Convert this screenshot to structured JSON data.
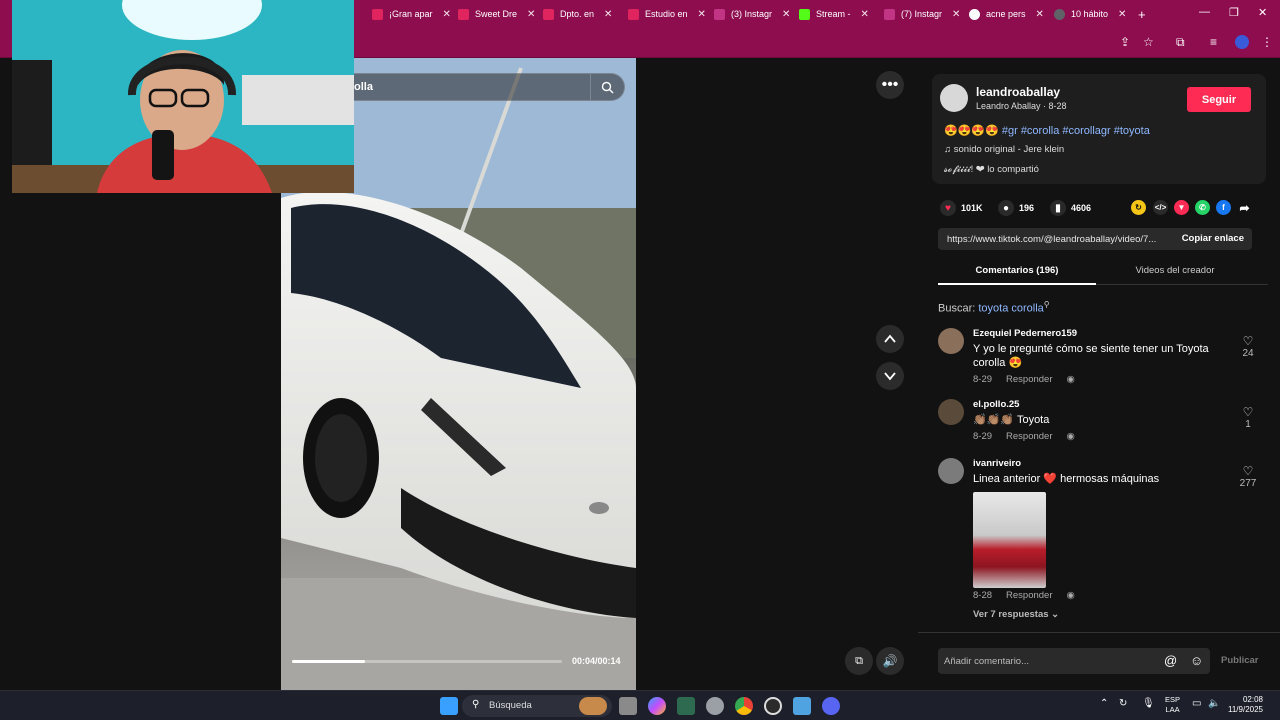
{
  "browser": {
    "tabs": [
      {
        "label": "¡Gran apar",
        "color": "#e0245e"
      },
      {
        "label": "Sweet Dre",
        "color": "#e0245e"
      },
      {
        "label": "Dpto. en",
        "color": "#e0245e"
      },
      {
        "label": "Estudio en",
        "color": "#e0245e"
      },
      {
        "label": "(3) Instagr",
        "color": "#c13584"
      },
      {
        "label": "Stream -",
        "color": "#53fc18"
      },
      {
        "label": "(7) Instagr",
        "color": "#c13584"
      },
      {
        "label": "acne pers",
        "color": "#ffffff"
      },
      {
        "label": "10 hábito",
        "color": "#5f6368"
      }
    ],
    "new_tab": "+",
    "window_controls": [
      "—",
      "❐",
      "✕"
    ]
  },
  "video": {
    "search_text": "olla",
    "time": "00:04/00:14",
    "progress": 0.27
  },
  "post": {
    "username": "leandroaballay",
    "display_name": "Leandro Aballay · 8-28",
    "follow": "Seguir",
    "caption_emoji": "😍😍😍😍",
    "caption_tags": "#gr #corolla #corollagr #toyota",
    "sound": "♫ sonido original - Jere klein",
    "shared": "𝓼𝓸𝓯𝓲𝓲𝓲𝓲! ❤ lo compartió",
    "likes": "101K",
    "comments": "196",
    "saves": "4606",
    "link": "https://www.tiktok.com/@leandroaballay/video/7...",
    "copy_link": "Copiar enlace",
    "tab_comments": "Comentarios (196)",
    "tab_videos": "Videos del creador",
    "search_label": "Buscar:",
    "search_query": "toyota corolla"
  },
  "comments": [
    {
      "user": "Ezequiel Pedernero159",
      "text": "Y yo le pregunté cómo se siente tener un Toyota corolla 😍",
      "date": "8-29",
      "reply": "Responder",
      "likes": "24"
    },
    {
      "user": "el.pollo.25",
      "text": "👏🏽👏🏽👏🏽 Toyota",
      "date": "8-29",
      "reply": "Responder",
      "likes": "1"
    },
    {
      "user": "ivanriveiro",
      "text": "Linea anterior ❤️ hermosas máquinas",
      "date": "8-28",
      "reply": "Responder",
      "likes": "277",
      "more": "Ver 7 respuestas ⌄"
    }
  ],
  "comment_input": {
    "placeholder": "Añadir comentario...",
    "publish": "Publicar"
  },
  "taskbar": {
    "search": "Búsqueda",
    "lang_top": "ESP",
    "lang_bottom": "LAA",
    "time": "02:08",
    "date": "11/9/2025"
  }
}
